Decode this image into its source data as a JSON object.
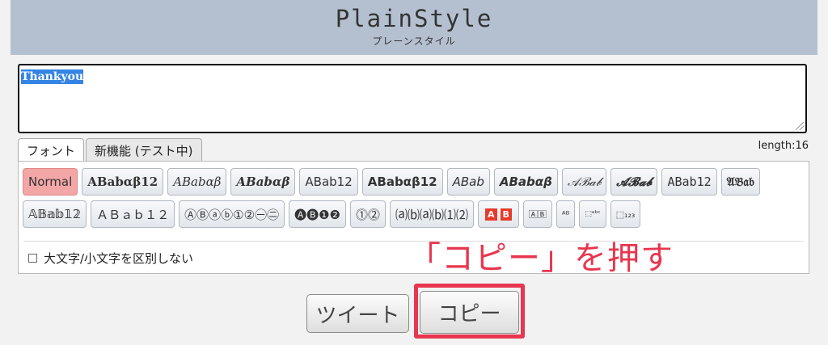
{
  "header": {
    "logo": "PlainStyle",
    "subtitle": "プレーンスタイル"
  },
  "input": {
    "value": "Thankyou"
  },
  "tabs": [
    {
      "label": "フォント",
      "active": true
    },
    {
      "label": "新機能 (テスト中)",
      "active": false
    }
  ],
  "length_label": "length:16",
  "font_buttons": [
    {
      "label": "Normal",
      "style": "normal"
    },
    {
      "label": "ABabαβ12",
      "style": "serif-b"
    },
    {
      "label": "ABabαβ",
      "style": "serif-i"
    },
    {
      "label": "ABabαβ",
      "style": "serif-bi"
    },
    {
      "label": "ABab12",
      "style": "sans"
    },
    {
      "label": "ABabαβ12",
      "style": "sans-b"
    },
    {
      "label": "ABab",
      "style": "sans-i"
    },
    {
      "label": "ABabαβ",
      "style": "sans-bi"
    },
    {
      "label": "𝒜ℬ𝒶𝒷",
      "style": "script"
    },
    {
      "label": "𝓐𝓑𝓪𝓫",
      "style": "script-b"
    },
    {
      "label": "ABab12",
      "style": "mono"
    },
    {
      "label": "𝔄𝔅𝔞𝔟",
      "style": "fraktur"
    },
    {
      "label": "𝔸𝔹𝕒𝕓𝟙𝟚",
      "style": "double-struck"
    },
    {
      "label": "ＡＢａｂ１２",
      "style": "fullwidth"
    },
    {
      "label": "ⒶⒷⓐⓑ①②㊀㊁",
      "style": "circled"
    },
    {
      "label": "🅐🅑❶❷",
      "style": "neg-circled"
    },
    {
      "label": "⓵⓶",
      "style": "double-circled"
    },
    {
      "label": "⒜⒝⒜⒝⑴⑵",
      "style": "parenthesized"
    },
    {
      "label": "🅰🅱",
      "style": "red-square"
    },
    {
      "label": "🄰🄱",
      "style": "squared"
    },
    {
      "label": "ᴬᴮ",
      "style": "small"
    },
    {
      "label": "⬚ᵃᵇᶜ",
      "style": "superscript"
    },
    {
      "label": "⬚₁₂₃",
      "style": "subscript"
    }
  ],
  "case_option": {
    "label": "大文字/小文字を区別しない",
    "checked": false
  },
  "annotation": "「コピー」を押す",
  "actions": {
    "tweet": "ツイート",
    "copy": "コピー"
  },
  "colors": {
    "header_bg": "#b4c0d0",
    "annotation": "#e8364e",
    "normal_button": "#f3a6a6",
    "selection": "#3584e4"
  }
}
